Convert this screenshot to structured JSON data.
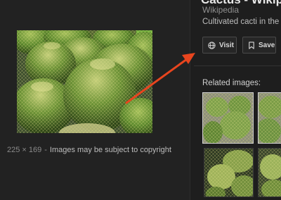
{
  "result": {
    "title": "Cactus - Wikip",
    "source": "Wikipedia",
    "caption": "Cultivated cacti in the S",
    "visit_label": "Visit",
    "save_label": "Save"
  },
  "image": {
    "dimensions": "225 × 169",
    "separator": "-",
    "copyright_notice": "Images may be subject to copyright"
  },
  "related": {
    "label": "Related images:"
  },
  "colors": {
    "background": "#222222",
    "arrow": "#e8451e",
    "cactus_green": "#5d8a2e",
    "spine_yellow": "#e2df8a"
  },
  "icons": {
    "visit": "globe-icon",
    "save": "bookmark-icon"
  }
}
